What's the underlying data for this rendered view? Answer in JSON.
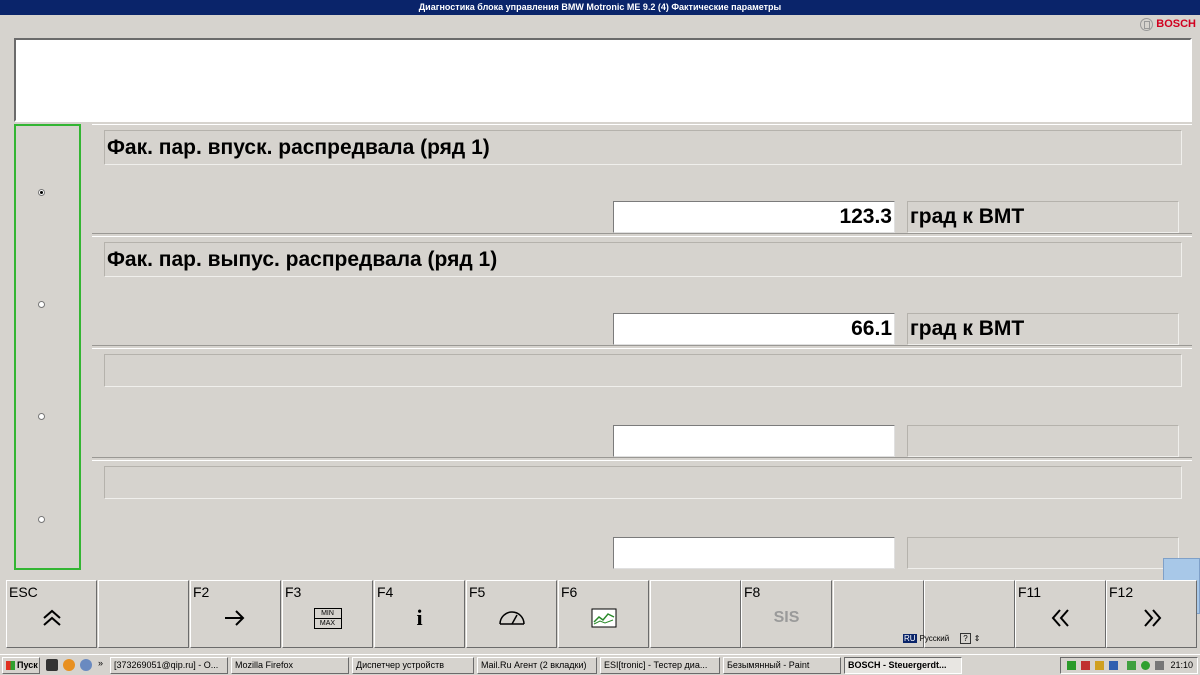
{
  "window": {
    "title": "Диагностика блока управления BMW Motronic ME 9.2 (4) Фактические параметры"
  },
  "brand": {
    "logo": "BOSCH"
  },
  "params": [
    {
      "label": "Фак. пар. впуск. распредвала (ряд 1)",
      "value": "123.3",
      "unit": "град к ВМТ",
      "selected": true
    },
    {
      "label": "Фак. пар. выпус. распредвала (ряд 1)",
      "value": "66.1",
      "unit": "град к ВМТ",
      "selected": false
    },
    {
      "label": "",
      "value": "",
      "unit": "",
      "selected": false
    },
    {
      "label": "",
      "value": "",
      "unit": "",
      "selected": false
    }
  ],
  "fkeys": [
    {
      "key": "ESC",
      "icon": "double-chevron-up-icon",
      "glyph": "︽"
    },
    {
      "key": "",
      "icon": "",
      "glyph": ""
    },
    {
      "key": "F2",
      "icon": "enter-arrow-icon",
      "glyph": "⇨"
    },
    {
      "key": "F3",
      "icon": "min-max-icon",
      "min": "MIN",
      "max": "MAX"
    },
    {
      "key": "F4",
      "icon": "info-icon",
      "glyph": "i"
    },
    {
      "key": "F5",
      "icon": "gauge-icon",
      "glyph": "⌓"
    },
    {
      "key": "F6",
      "icon": "chart-icon",
      "glyph": "▭"
    },
    {
      "key": "",
      "icon": "",
      "glyph": ""
    },
    {
      "key": "F8",
      "icon": "sis-text",
      "glyph": "SIS"
    },
    {
      "key": "",
      "icon": "",
      "glyph": ""
    },
    {
      "key": "",
      "icon": "",
      "glyph": ""
    },
    {
      "key": "F11",
      "icon": "double-chevron-left-icon",
      "glyph": "«"
    },
    {
      "key": "F12",
      "icon": "double-chevron-right-icon",
      "glyph": "»"
    }
  ],
  "language": {
    "code": "RU",
    "name": "Русский",
    "help": "?"
  },
  "taskbar": {
    "start": "Пуск",
    "items": [
      "[373269051@qip.ru] - O...",
      "Mozilla Firefox",
      "Диспетчер устройств",
      "Mail.Ru Агент (2 вкладки)",
      "ESI[tronic] - Тестер диа...",
      "Безымянный - Paint",
      "BOSCH - Steuergerdt..."
    ],
    "clock": "21:10"
  }
}
